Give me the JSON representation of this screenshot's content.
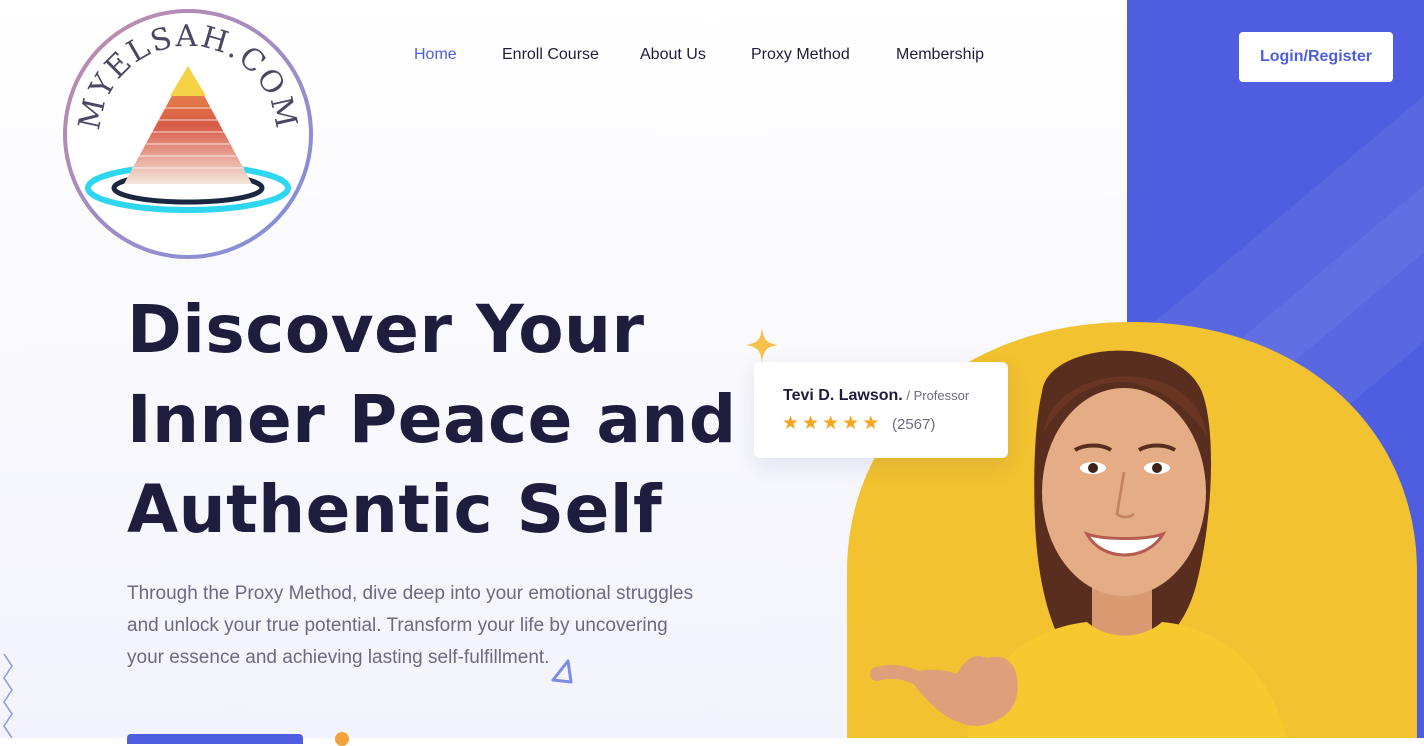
{
  "logo": {
    "text": "MYELSAH.COM",
    "icon": "pyramid-logo-icon"
  },
  "nav": {
    "items": [
      {
        "label": "Home",
        "active": true
      },
      {
        "label": "Enroll Course",
        "active": false
      },
      {
        "label": "About Us",
        "active": false
      },
      {
        "label": "Proxy Method",
        "active": false
      },
      {
        "label": "Membership",
        "active": false
      }
    ]
  },
  "header": {
    "login_label": "Login/Register"
  },
  "hero": {
    "title_lines": [
      "Discover Your",
      "Inner Peace and",
      "Authentic Self"
    ],
    "description": "Through the Proxy Method, dive deep into your emotional struggles and unlock your true potential. Transform your life by uncovering your essence and achieving lasting self-fulfillment."
  },
  "review": {
    "name": "Tevi D. Lawson.",
    "role": " / Professor",
    "rating": 5,
    "count": "(2567)"
  },
  "colors": {
    "accent": "#4f5ee0",
    "dark_text": "#1f1d3d",
    "body_text": "#6c6a82",
    "star": "#f7a51f",
    "photo_bg": "#f2c230"
  }
}
